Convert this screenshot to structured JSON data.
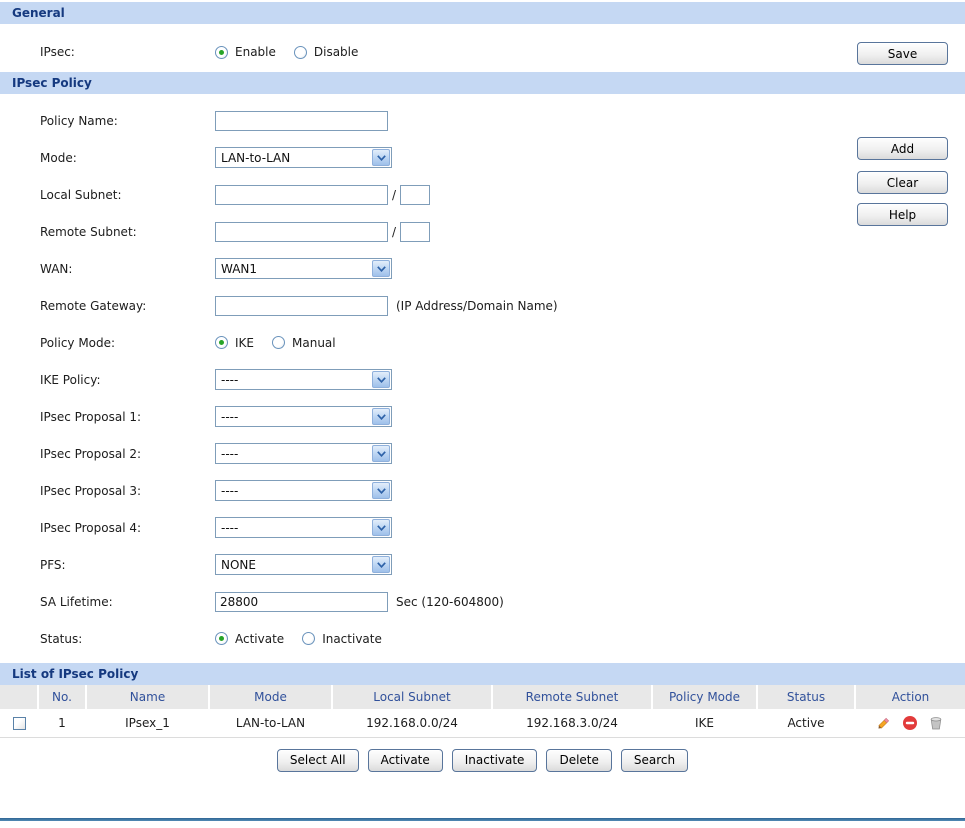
{
  "colors": {
    "section_bar_bg": "#C5D8F3",
    "section_title": "#15397F",
    "table_header_bg": "#E8E8E8",
    "table_header_text": "#31519B",
    "input_border": "#7F9DB9",
    "radio_selected_dot": "#27A427",
    "disable_icon_red": "#E23B3B",
    "bottom_rule_blue": "#3F75A3"
  },
  "general": {
    "title": "General",
    "label": "IPsec:",
    "enable": "Enable",
    "disable": "Disable",
    "save": "Save"
  },
  "policy": {
    "title": "IPsec Policy",
    "slash": "/",
    "side_buttons": [
      "Add",
      "Clear",
      "Help"
    ],
    "rows": [
      {
        "label": "Policy Name:",
        "type": "text",
        "value": ""
      },
      {
        "label": "Mode:",
        "type": "select",
        "value": "LAN-to-LAN"
      },
      {
        "label": "Local Subnet:",
        "type": "subnet",
        "value": "",
        "mask": ""
      },
      {
        "label": "Remote Subnet:",
        "type": "subnet",
        "value": "",
        "mask": ""
      },
      {
        "label": "WAN:",
        "type": "select",
        "value": "WAN1"
      },
      {
        "label": "Remote Gateway:",
        "type": "text",
        "value": "",
        "note": "(IP Address/Domain Name)"
      },
      {
        "label": "Policy Mode:",
        "type": "radio",
        "options": [
          "IKE",
          "Manual"
        ],
        "selected": "IKE"
      },
      {
        "label": "IKE Policy:",
        "type": "select",
        "value": "----"
      },
      {
        "label": "IPsec Proposal 1:",
        "type": "select",
        "value": "----"
      },
      {
        "label": "IPsec Proposal 2:",
        "type": "select",
        "value": "----"
      },
      {
        "label": "IPsec Proposal 3:",
        "type": "select",
        "value": "----"
      },
      {
        "label": "IPsec Proposal 4:",
        "type": "select",
        "value": "----"
      },
      {
        "label": "PFS:",
        "type": "select",
        "value": "NONE"
      },
      {
        "label": "SA Lifetime:",
        "type": "text",
        "value": "28800",
        "note": "Sec (120-604800)"
      },
      {
        "label": "Status:",
        "type": "radio",
        "options": [
          "Activate",
          "Inactivate"
        ],
        "selected": "Activate"
      }
    ]
  },
  "list": {
    "title": "List of IPsec Policy",
    "headers": [
      "No.",
      "Name",
      "Mode",
      "Local Subnet",
      "Remote Subnet",
      "Policy Mode",
      "Status",
      "Action"
    ],
    "rows": [
      {
        "no": "1",
        "name": "IPsex_1",
        "mode": "LAN-to-LAN",
        "local_subnet": "192.168.0.0/24",
        "remote_subnet": "192.168.3.0/24",
        "policy_mode": "IKE",
        "status": "Active"
      }
    ],
    "footer_buttons": [
      "Select All",
      "Activate",
      "Inactivate",
      "Delete",
      "Search"
    ]
  }
}
